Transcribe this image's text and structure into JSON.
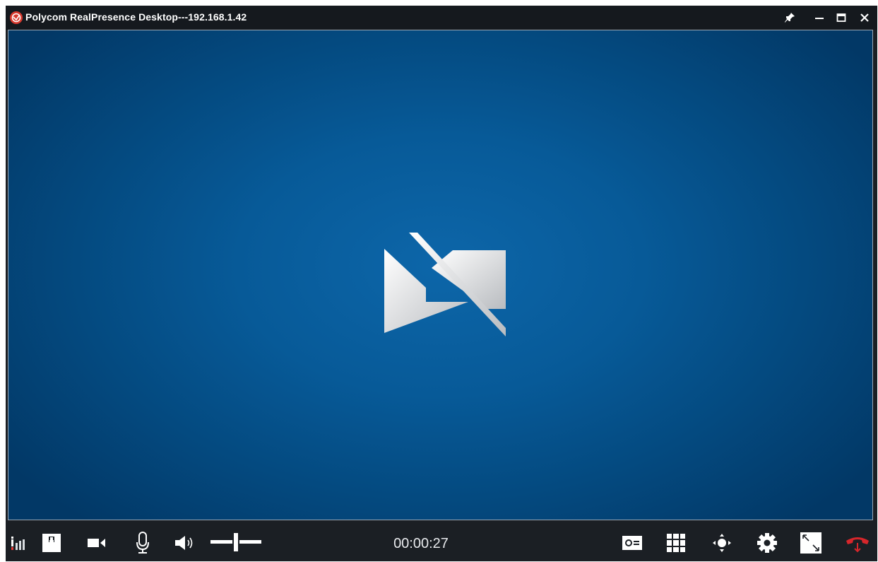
{
  "window": {
    "title": "Polycom RealPresence Desktop---192.168.1.42"
  },
  "titlebar": {
    "buttons": [
      "pin-icon",
      "minimize-icon",
      "maximize-icon",
      "close-icon"
    ]
  },
  "video": {
    "state": "video-off",
    "background_color": "#075a98",
    "icon": "video-off-icon"
  },
  "toolbar": {
    "timer": "00:00:27",
    "volume_level": 0.5,
    "left_controls": [
      "signal-strength-icon",
      "self-view-icon",
      "camera-icon",
      "microphone-icon",
      "speaker-icon",
      "volume-slider"
    ],
    "right_controls": [
      "content-share-icon",
      "dialpad-icon",
      "far-end-camera-icon",
      "settings-icon",
      "fullscreen-icon",
      "hang-up-icon"
    ],
    "hangup_color": "#d7262b"
  }
}
